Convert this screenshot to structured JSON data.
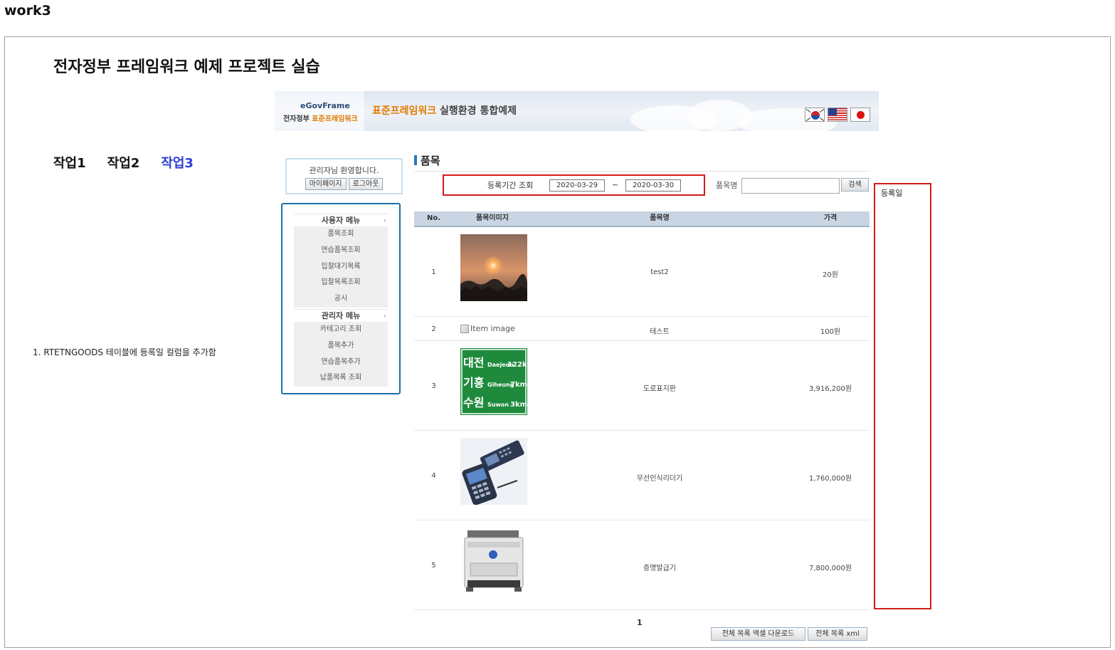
{
  "page": {
    "heading": "work3",
    "title": "전자정부 프레임워크 예제 프로젝트 실습"
  },
  "banner": {
    "logo_top": "eGovFrame",
    "logo_bottom_prefix": "전자정부 ",
    "logo_bottom_highlight": "표준프레임워크",
    "title_highlight": "표준프레임워크",
    "title_rest": " 실행환경 통합예제",
    "flags": [
      "flag-korea-icon",
      "flag-usa-icon",
      "flag-japan-icon"
    ]
  },
  "work_nav": [
    {
      "label": "작업1",
      "active": false
    },
    {
      "label": "작업2",
      "active": false
    },
    {
      "label": "작업3",
      "active": true
    }
  ],
  "note": "1. RTETNGOODS 테이블에 등록일 컬럼을 추가함",
  "login": {
    "welcome": "관리자님 환영합니다.",
    "mypage": "마이페이지",
    "logout": "로그아웃"
  },
  "menu": {
    "user_header": "사용자 메뉴",
    "user_items": [
      "품목조회",
      "연습품목조회",
      "입찰대기목록",
      "입찰목록조회",
      "공시"
    ],
    "admin_header": "관리자 메뉴",
    "admin_items": [
      "카테고리 조회",
      "품목추가",
      "연습품목추가",
      "납품목록 조회"
    ],
    "chevron": "›"
  },
  "content": {
    "title": "품목",
    "search": {
      "period_label": "등록기간 조회",
      "date_from": "2020-03-29",
      "tilde": "~",
      "date_to": "2020-03-30",
      "name_label": "품목명",
      "name_value": "",
      "button": "검색"
    },
    "regdate_label": "등록일",
    "table": {
      "headers": {
        "no": "No.",
        "image": "품목이미지",
        "name": "품목명",
        "price": "가격"
      },
      "rows": [
        {
          "no": "1",
          "image": "sunset-photo",
          "name": "test2",
          "price": "20원"
        },
        {
          "no": "2",
          "image_alt": "Item image",
          "name": "테스트",
          "price": "100원"
        },
        {
          "no": "3",
          "image": "road-sign-photo",
          "name": "도로표지판",
          "price": "3,916,200원",
          "sign": [
            {
              "k": "대전",
              "e": "Daejeon",
              "d": "122km"
            },
            {
              "k": "기흥",
              "e": "Giheung",
              "d": "7km"
            },
            {
              "k": "수원",
              "e": "Suwon",
              "d": "3km"
            }
          ]
        },
        {
          "no": "4",
          "image": "barcode-scanner-photo",
          "name": "무선인식리더기",
          "price": "1,760,000원"
        },
        {
          "no": "5",
          "image": "certificate-printer-photo",
          "name": "증명발급기",
          "price": "7,800,000원"
        }
      ]
    },
    "pager": "1",
    "buttons": {
      "excel": "전체 목록 엑셀 다운로드",
      "xml": "전체 목록 xml"
    }
  }
}
